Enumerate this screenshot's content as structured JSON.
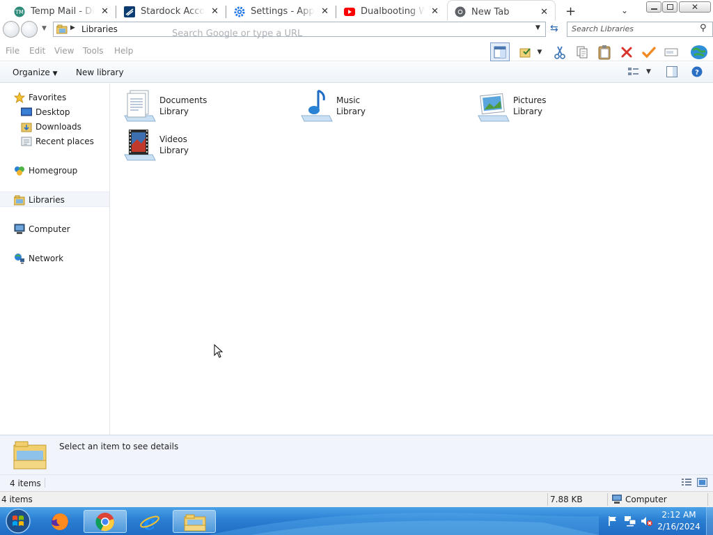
{
  "browser": {
    "tabs": [
      {
        "title": "Temp Mail - Disp",
        "icon": "tempmail-icon",
        "active": false
      },
      {
        "title": "Stardock Account",
        "icon": "stardock-icon",
        "active": false
      },
      {
        "title": "Settings - Appear",
        "icon": "settings-gear-icon",
        "active": false
      },
      {
        "title": "Dualbooting Win",
        "icon": "youtube-icon",
        "active": false
      },
      {
        "title": "New Tab",
        "icon": "chrome-icon",
        "active": true
      }
    ],
    "omnibox_placeholder": "Search Google or type a URL"
  },
  "explorer": {
    "address": "Libraries",
    "search_placeholder": "Search Libraries",
    "menu": [
      "File",
      "Edit",
      "View",
      "Tools",
      "Help"
    ],
    "commands": {
      "organize": "Organize",
      "new_library": "New library"
    },
    "nav": {
      "favorites": "Favorites",
      "desktop": "Desktop",
      "downloads": "Downloads",
      "recent": "Recent places",
      "homegroup": "Homegroup",
      "libraries": "Libraries",
      "computer": "Computer",
      "network": "Network"
    },
    "libraries": [
      {
        "name": "Documents",
        "type": "Library",
        "icon": "documents-library-icon"
      },
      {
        "name": "Music",
        "type": "Library",
        "icon": "music-library-icon"
      },
      {
        "name": "Pictures",
        "type": "Library",
        "icon": "pictures-library-icon"
      },
      {
        "name": "Videos",
        "type": "Library",
        "icon": "videos-library-icon"
      }
    ],
    "details_text": "Select an item to see details",
    "status_count": "4 items",
    "status2": {
      "count": "4 items",
      "size": "7.88 KB",
      "zone": "Computer"
    }
  },
  "taskbar": {
    "time": "2:12 AM",
    "date": "2/16/2024"
  },
  "colors": {
    "taskbar": "#2b7fd2",
    "accent": "#3c7fb1"
  }
}
